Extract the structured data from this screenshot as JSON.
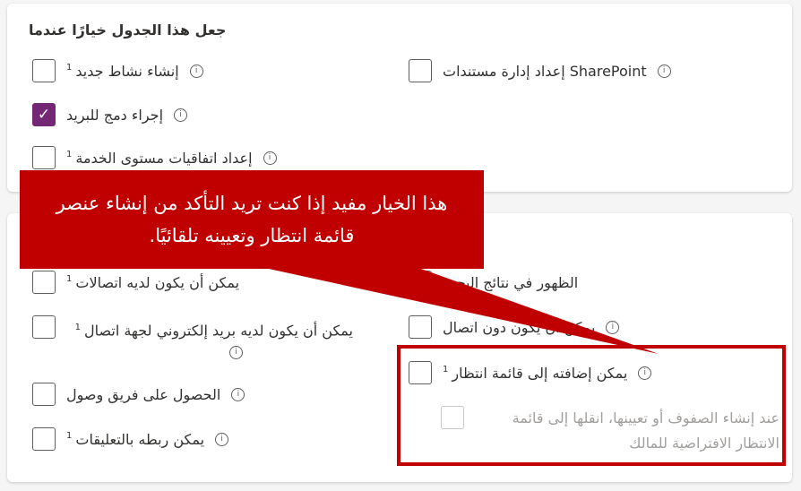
{
  "card1": {
    "heading": "جعل هذا الجدول خيارًا عندما",
    "items": [
      {
        "label": "إنشاء نشاط جديد",
        "sup": "1",
        "checked": false
      },
      {
        "label": "SharePoint إعداد إدارة مستندات",
        "sup": "",
        "checked": false
      },
      {
        "label": "إجراء دمج للبريد",
        "sup": "",
        "checked": true
      },
      {
        "label": "إعداد اتفاقيات مستوى الخدمة",
        "sup": "1",
        "checked": false
      }
    ]
  },
  "card2": {
    "items": [
      {
        "label": "يمكن أن يكون لديه اتصالات",
        "sup": "1",
        "checked": false
      },
      {
        "label": "الظهور في نتائج البحث",
        "sup": "",
        "checked": false
      },
      {
        "label": "يمكن أن يكون لديه بريد إلكتروني لجهة اتصال",
        "sup": "1",
        "checked": false
      },
      {
        "label": "يمكن أن يكون دون اتصال",
        "sup": "",
        "checked": false
      },
      {
        "label": "يمكن إضافته إلى قائمة انتظار",
        "sup": "1",
        "checked": false
      },
      {
        "label": "الحصول على فريق وصول",
        "sup": "",
        "checked": false
      },
      {
        "label": "عند إنشاء الصفوف أو تعيينها، انقلها إلى قائمة الانتظار الافتراضية للمالك",
        "sup": "",
        "checked": false,
        "disabled": true
      },
      {
        "label": "يمكن ربطه بالتعليقات",
        "sup": "1",
        "checked": false
      }
    ]
  },
  "callout": {
    "text": "هذا الخيار مفيد إذا كنت تريد التأكد من إنشاء عنصر قائمة انتظار وتعيينه تلقائيًا.",
    "color": "#c00000"
  },
  "colors": {
    "accent": "#742774"
  },
  "icons": {
    "info": "info-icon",
    "check": "checkmark-icon"
  }
}
